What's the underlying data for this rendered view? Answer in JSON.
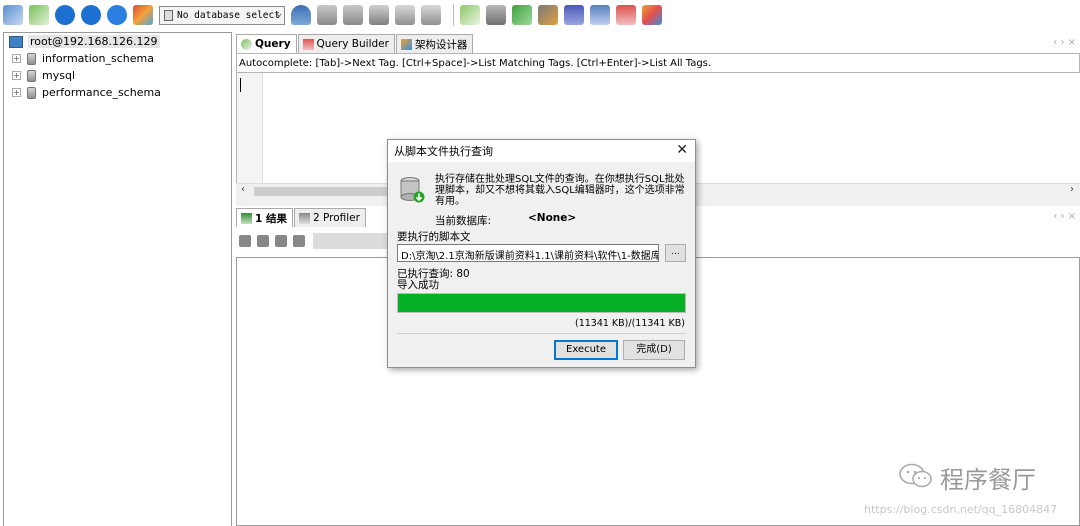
{
  "toolbar": {
    "db_select_value": "No database select",
    "icons_left": [
      "connect-icon",
      "new-connection-icon",
      "execute-icon",
      "execute-all-icon",
      "refresh-icon",
      "schema-icon"
    ],
    "icons_right": [
      "user-manager-icon",
      "backup-icon",
      "restore-icon",
      "export-icon",
      "import-icon",
      "table-data-icon",
      "sync-icon",
      "query-builder-icon",
      "schema-sync-icon",
      "job-icon",
      "notification-icon",
      "designer-icon",
      "tools-icon"
    ]
  },
  "tree": {
    "root": "root@192.168.126.129",
    "databases": [
      "information_schema",
      "mysql",
      "performance_schema"
    ]
  },
  "query_tabs": [
    "Query",
    "Query Builder",
    "架构设计器"
  ],
  "autocomplete_hint": "Autocomplete: [Tab]->Next Tag. [Ctrl+Space]->List Matching Tags. [Ctrl+Enter]->List All Tags.",
  "result_tabs": [
    "1 结果",
    "2 Profiler"
  ],
  "dialog": {
    "title": "从脚本文件执行查询",
    "description": "执行存储在批处理SQL文件的查询。在你想执行SQL批处理脚本，却又不想将其载入SQL编辑器时，这个选项非常有用。",
    "current_db_label": "当前数据库:",
    "current_db_value": "<None>",
    "script_label": "要执行的脚本文",
    "script_path": "D:\\京淘\\2.1京淘新版课前资料1.1\\课前资料\\软件\\1-数据库",
    "browse_label": "...",
    "executed_label": "已执行查询: 80",
    "status": "导入成功",
    "progress": 1.0,
    "size_text": "(11341 KB)/(11341 KB)",
    "execute_button": "Execute",
    "done_button": "完成(D)"
  },
  "watermark": {
    "brand": "程序餐厅",
    "url": "https://blog.csdn.net/qq_16804847"
  },
  "colors": {
    "progress_fill": "#06b025",
    "focus_border": "#0078d7"
  }
}
